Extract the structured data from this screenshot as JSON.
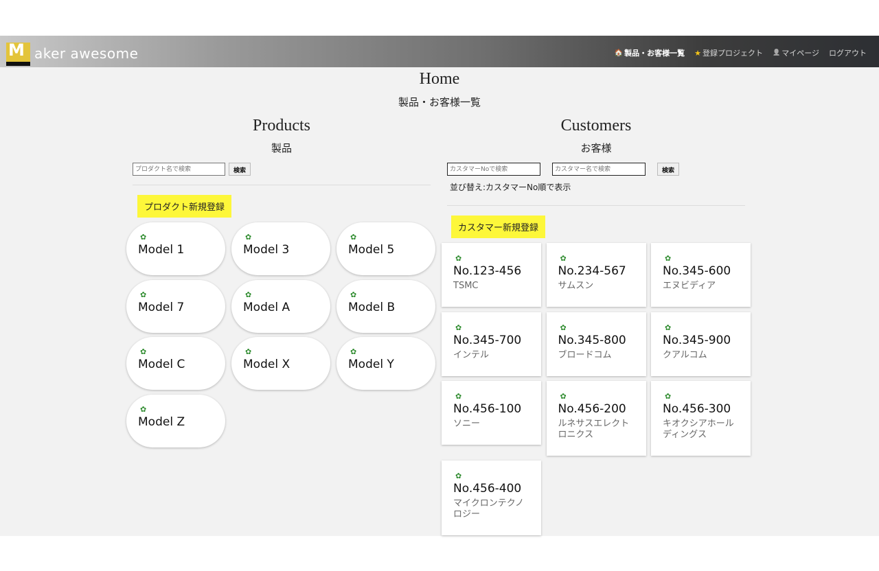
{
  "header": {
    "logo_letter": "M",
    "logo_text": "aker awesome",
    "nav": [
      {
        "icon": "home-icon",
        "glyph": "🏠",
        "label": "製品・お客様一覧",
        "active": true
      },
      {
        "icon": "star-icon",
        "glyph": "★",
        "label": "登録プロジェクト",
        "active": false
      },
      {
        "icon": "user-icon",
        "glyph": "👤",
        "label": "マイページ",
        "active": false
      },
      {
        "icon": "",
        "glyph": "",
        "label": "ログアウト",
        "active": false
      }
    ]
  },
  "page": {
    "title": "Home",
    "subtitle": "製品・お客様一覧"
  },
  "products": {
    "title": "Products",
    "subtitle": "製品",
    "search_placeholder": "プロダクト名で検索",
    "search_button": "検索",
    "new_button": "プロダクト新規登録",
    "gear_glyph": "✿",
    "items": [
      "Model 1",
      "Model 3",
      "Model 5",
      "Model 7",
      "Model A",
      "Model B",
      "Model C",
      "Model X",
      "Model Y",
      "Model Z"
    ]
  },
  "customers": {
    "title": "Customers",
    "subtitle": "お客様",
    "search_no_placeholder": "カスタマーNoで検索",
    "search_name_placeholder": "カスタマー名で検索",
    "search_button": "検索",
    "sort_text": "並び替え:カスタマーNo順で表示",
    "new_button": "カスタマー新規登録",
    "gear_glyph": "✿",
    "items": [
      {
        "no": "No.123-456",
        "name": "TSMC"
      },
      {
        "no": "No.234-567",
        "name": "サムスン"
      },
      {
        "no": "No.345-600",
        "name": "エヌビディア"
      },
      {
        "no": "No.345-700",
        "name": "インテル"
      },
      {
        "no": "No.345-800",
        "name": "ブロードコム"
      },
      {
        "no": "No.345-900",
        "name": "クアルコム"
      },
      {
        "no": "No.456-100",
        "name": "ソニー"
      },
      {
        "no": "No.456-200",
        "name": "ルネサスエレクトロニクス"
      },
      {
        "no": "No.456-300",
        "name": "キオクシアホールディングス"
      },
      {
        "no": "No.456-400",
        "name": "マイクロンテクノロジー"
      }
    ]
  },
  "colors": {
    "accent_yellow": "#fdf73a",
    "logo_yellow": "#e3c43b",
    "gear_green": "#2e8b2e"
  }
}
